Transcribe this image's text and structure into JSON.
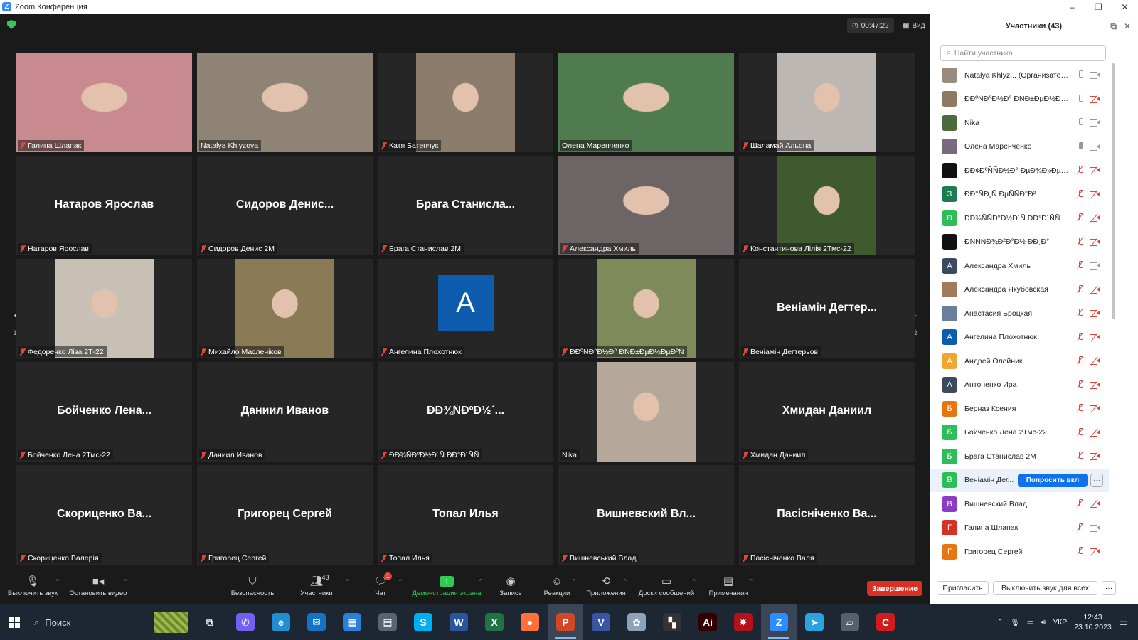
{
  "window": {
    "title": "Zoom Конференция",
    "controls": [
      "–",
      "❐",
      "✕"
    ]
  },
  "meeting": {
    "timer": "00:47:22",
    "view_label": "Вид",
    "page_left": "1/2",
    "page_right": "1/2",
    "tiles": [
      {
        "label": "Галина Шлапак",
        "muted": true,
        "video": true,
        "bg": "#c98a8f"
      },
      {
        "label": "Natalya Khlyzova",
        "muted": false,
        "video": true,
        "bg": "#8f8376"
      },
      {
        "label": "Катя Батенчук",
        "muted": true,
        "video": true,
        "bg": "#8c7c6c"
      },
      {
        "label": "Олена Маренченко",
        "muted": false,
        "video": true,
        "active": true,
        "bg": "#4f7b4f"
      },
      {
        "label": "Шаламай Альона",
        "muted": true,
        "video": true,
        "bg": "#bdb7b3"
      },
      {
        "big": "Натаров Ярослав",
        "label": "Натаров Ярослав",
        "muted": true
      },
      {
        "big": "Сидоров Денис...",
        "label": "Сидоров Денис 2М",
        "muted": true
      },
      {
        "big": "Брага Станисла...",
        "label": "Брага Станислав 2М",
        "muted": true
      },
      {
        "label": "Александра Хмиль",
        "muted": true,
        "video": true,
        "bg": "#6d6466"
      },
      {
        "label": "Константинова Лілія 2Тмс-22",
        "muted": true,
        "video": true,
        "bg": "#3f5a2f"
      },
      {
        "label": "Федоренко Ліза 2Т-22",
        "muted": true,
        "video": true,
        "bg": "#c8c0b5"
      },
      {
        "label": "Михайло Масленіков",
        "muted": true,
        "video": true,
        "bg": "#8a7a55"
      },
      {
        "letter": "A",
        "label": "Ангелина  Плохотнюк",
        "muted": true
      },
      {
        "label": "ÐÐºÑÐ°Ð½Ð° ÐÑÐ±ÐµÐ½ÐµÐºÑ",
        "muted": true,
        "video": true,
        "bg": "#7f8a5a"
      },
      {
        "big": "Веніамін Дегтер...",
        "label": "Веніамін Дегтерьов",
        "muted": true
      },
      {
        "big": "Бойченко  Лена...",
        "label": "Бойченко Лена 2Тмс-22",
        "muted": true
      },
      {
        "big": "Даниил Иванов",
        "label": "Даниил Иванов",
        "muted": true
      },
      {
        "big": "ÐÐ¾ÑÐºÐ½´...",
        "label": "ÐÐ¾ÑÐºÐ½Ð´Ñ ÐÐ°Ð´ÑÑ",
        "muted": true
      },
      {
        "label": "Nika",
        "muted": false,
        "video": true,
        "bg": "#b5a79a"
      },
      {
        "big": "Хмидан Даниил",
        "label": "Хмидан Даниил",
        "muted": true
      },
      {
        "big": "Скориценко  Ва...",
        "label": "Скориценко Валерія",
        "muted": true
      },
      {
        "big": "Григорец Сергей",
        "label": "Григорец Сергей",
        "muted": true
      },
      {
        "big": "Топал Илья",
        "label": "Топал Илья",
        "muted": true
      },
      {
        "big": "Вишневский  Вл...",
        "label": "Вишневський Влад",
        "muted": true
      },
      {
        "big": "Пасісніченко  Ва...",
        "label": "Пасісніченко Валя",
        "muted": true
      }
    ]
  },
  "toolbar": {
    "mute": "Выключить звук",
    "video": "Остановить видео",
    "security": "Безопасность",
    "participants": "Участники",
    "participants_count": "43",
    "chat": "Чат",
    "chat_badge": "1",
    "share": "Демонстрация экрана",
    "record": "Запись",
    "reactions": "Реакции",
    "apps": "Приложения",
    "whiteboards": "Доски сообщений",
    "notes": "Примечания",
    "end": "Завершение"
  },
  "panel": {
    "title": "Участники (43)",
    "search_placeholder": "Найти участника",
    "ask_button": "Попросить вкл",
    "more": "···",
    "invite": "Пригласить",
    "mute_all": "Выключить звук для всех",
    "footer_more": "···",
    "participants": [
      {
        "name": "Natalya Khlyz... (Организатор, я)",
        "avatar": "",
        "color": "#9a8c7c",
        "mic": "off",
        "cam": "on"
      },
      {
        "name": "ÐÐºÑÐ°Ð½Ð° ÐÑÐ±ÐµÐ½ÐµÐºÑ",
        "avatar": "",
        "color": "#8c7a63",
        "mic": "off",
        "cam": "muted"
      },
      {
        "name": "Nika",
        "avatar": "",
        "color": "#4a6b3a",
        "mic": "off",
        "cam": "on"
      },
      {
        "name": "Олена Маренченко",
        "avatar": "",
        "color": "#7a6a80",
        "mic": "on",
        "cam": "on"
      },
      {
        "name": "ÐÐ¢ÐºÑÑÐ½Ð° ÐµÐ¾Ð»ÐµÐ½Ñ",
        "avatar": "",
        "color": "#111111",
        "mic": "muted",
        "cam": "muted"
      },
      {
        "name": "ÐÐ°ÑÐ¸Ñ ÐµÑÑÐ°Ð²",
        "avatar": "З",
        "color": "#1b7d4f",
        "mic": "muted",
        "cam": "muted"
      },
      {
        "name": "ÐÐ¾ÑÑÐ°Ð½Ð´Ñ ÐÐ°Ð´ÑÑ",
        "avatar": "Ð",
        "color": "#2ebd59",
        "mic": "muted",
        "cam": "muted"
      },
      {
        "name": "ÐÑÑÑÐ¾Ð²Ð°Ð½ ÐÐ¸Ð°",
        "avatar": "",
        "color": "#111111",
        "mic": "muted",
        "cam": "muted"
      },
      {
        "name": "Александра Хмиль",
        "avatar": "А",
        "color": "#3b4a5e",
        "mic": "muted",
        "cam": "on"
      },
      {
        "name": "Александра Якубовская",
        "avatar": "",
        "color": "#a07a5a",
        "mic": "muted",
        "cam": "muted"
      },
      {
        "name": "Анастасия Броцкая",
        "avatar": "",
        "color": "#6a7fa0",
        "mic": "muted",
        "cam": "muted"
      },
      {
        "name": "Ангелина  Плохотнюк",
        "avatar": "А",
        "color": "#0e5cad",
        "mic": "muted",
        "cam": "muted"
      },
      {
        "name": "Андрей Олейник",
        "avatar": "А",
        "color": "#f2a531",
        "mic": "muted",
        "cam": "muted"
      },
      {
        "name": "Антоненко Ира",
        "avatar": "А",
        "color": "#3b4a5e",
        "mic": "muted",
        "cam": "muted"
      },
      {
        "name": "Берназ Ксения",
        "avatar": "Б",
        "color": "#e8760f",
        "mic": "muted",
        "cam": "muted"
      },
      {
        "name": "Бойченко Лена 2Тмс-22",
        "avatar": "Б",
        "color": "#2ebd59",
        "mic": "muted",
        "cam": "muted"
      },
      {
        "name": "Брага Станислав 2М",
        "avatar": "Б",
        "color": "#2ebd59",
        "mic": "muted",
        "cam": "muted"
      },
      {
        "name": "Веніамін Дег...",
        "avatar": "В",
        "color": "#2ebd59",
        "hover": true
      },
      {
        "name": "Вишневский Влад",
        "avatar": "В",
        "color": "#8a3cc4",
        "mic": "muted",
        "cam": "muted"
      },
      {
        "name": "Галина Шлапак",
        "avatar": "Г",
        "color": "#d93025",
        "mic": "muted",
        "cam": "on"
      },
      {
        "name": "Григорец Сергей",
        "avatar": "Г",
        "color": "#e8760f",
        "mic": "muted",
        "cam": "muted"
      }
    ]
  },
  "taskbar": {
    "search_label": "Поиск",
    "language": "УКР",
    "time": "12:43",
    "date": "23.10.2023",
    "apps": [
      {
        "name": "task-view",
        "glyph": "⧉",
        "color": "transparent"
      },
      {
        "name": "viber",
        "glyph": "✆",
        "color": "#7360f2"
      },
      {
        "name": "edge",
        "glyph": "e",
        "color": "#1f8fd1"
      },
      {
        "name": "mail",
        "glyph": "✉",
        "color": "#1673c4"
      },
      {
        "name": "calendar",
        "glyph": "▦",
        "color": "#2b7fd8"
      },
      {
        "name": "calculator",
        "glyph": "▤",
        "color": "#5a6470"
      },
      {
        "name": "skype",
        "glyph": "S",
        "color": "#00aff0"
      },
      {
        "name": "word",
        "glyph": "W",
        "color": "#2b579a"
      },
      {
        "name": "excel",
        "glyph": "X",
        "color": "#217346"
      },
      {
        "name": "firefox",
        "glyph": "●",
        "color": "#ff7139"
      },
      {
        "name": "powerpoint",
        "glyph": "P",
        "color": "#d24726",
        "open": true
      },
      {
        "name": "visio",
        "glyph": "V",
        "color": "#3955a3"
      },
      {
        "name": "paint",
        "glyph": "✿",
        "color": "#8fa3b8"
      },
      {
        "name": "clapper",
        "glyph": "▚",
        "color": "#333333"
      },
      {
        "name": "illustrator",
        "glyph": "Ai",
        "color": "#330000"
      },
      {
        "name": "app-red",
        "glyph": "✸",
        "color": "#b3121a"
      },
      {
        "name": "zoom",
        "glyph": "Z",
        "color": "#2d8cff",
        "open": true
      },
      {
        "name": "telegram",
        "glyph": "➤",
        "color": "#2aa3de"
      },
      {
        "name": "scanner",
        "glyph": "▱",
        "color": "#55606b"
      },
      {
        "name": "app-c",
        "glyph": "C",
        "color": "#d01c1c"
      }
    ]
  }
}
